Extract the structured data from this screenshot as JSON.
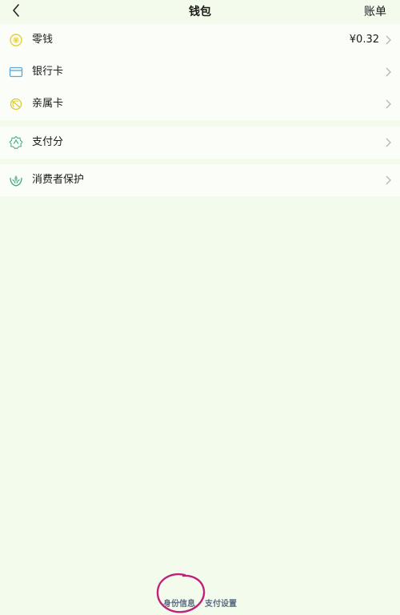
{
  "header": {
    "title": "钱包",
    "right_label": "账单"
  },
  "groups": [
    {
      "items": [
        {
          "label": "零钱",
          "value": "¥0.32",
          "icon": "coin-icon"
        },
        {
          "label": "银行卡",
          "value": "",
          "icon": "bank-card-icon"
        },
        {
          "label": "亲属卡",
          "value": "",
          "icon": "family-card-icon"
        }
      ]
    },
    {
      "items": [
        {
          "label": "支付分",
          "value": "",
          "icon": "pay-score-icon"
        }
      ]
    },
    {
      "items": [
        {
          "label": "消费者保护",
          "value": "",
          "icon": "consumer-protection-icon"
        }
      ]
    }
  ],
  "footer": {
    "links": [
      "身份信息",
      "支付设置"
    ]
  },
  "colors": {
    "background": "#f3fcec",
    "card": "#fbfef8",
    "annotation_circle": "#c0217a",
    "footer_link": "#5b6a80"
  }
}
